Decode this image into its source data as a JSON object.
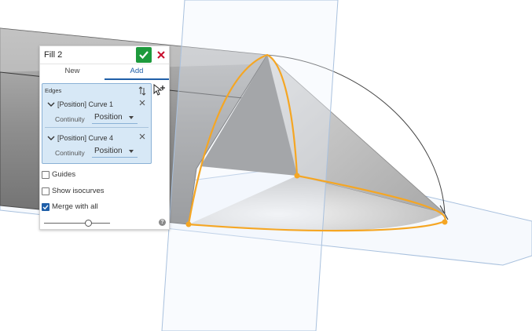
{
  "feature_panel": {
    "title": "Fill 2",
    "tabs": [
      {
        "label": "New",
        "active": false
      },
      {
        "label": "Add",
        "active": true
      }
    ],
    "edges": {
      "label": "Edges",
      "items": [
        {
          "name": "[Position] Curve 1",
          "continuity_label": "Continuity",
          "continuity_value": "Position"
        },
        {
          "name": "[Position] Curve 4",
          "continuity_label": "Continuity",
          "continuity_value": "Position"
        }
      ]
    },
    "options": [
      {
        "label": "Guides",
        "checked": false
      },
      {
        "label": "Show isocurves",
        "checked": false
      },
      {
        "label": "Merge with all",
        "checked": true
      }
    ],
    "slider_fraction": 0.68,
    "help_glyph": "?"
  },
  "icons": {
    "accept": "checkmark-icon",
    "cancel": "close-icon",
    "sort": "sort-arrows-icon",
    "expand": "chevron-down-icon",
    "remove": "close-icon",
    "help": "help-icon",
    "cursor": "select-cursor-plus-icon"
  },
  "colors": {
    "accept_green": "#1d9a3c",
    "cancel_red": "#c8102e",
    "accent_blue": "#1f5fa8",
    "selection_fill": "#d7e8f6",
    "highlight_orange": "#f5a623"
  }
}
